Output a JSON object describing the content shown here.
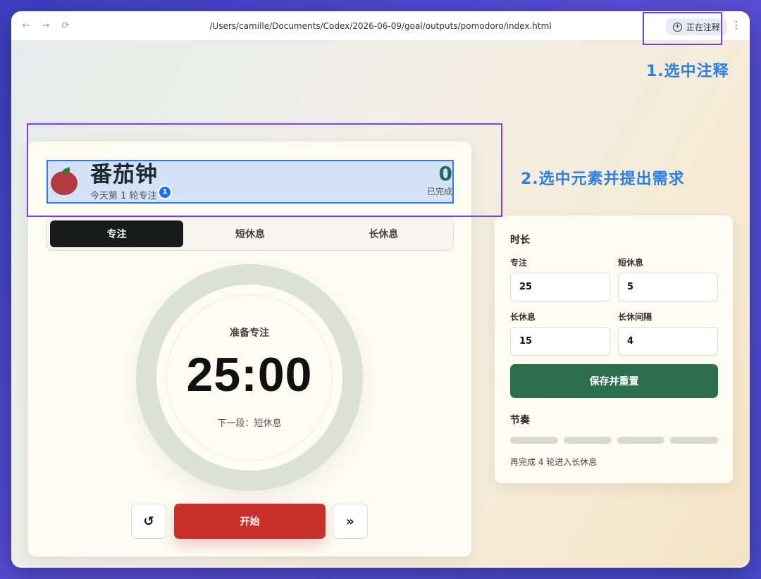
{
  "browser": {
    "url": "/Users/camille/Documents/Codex/2026-06-09/goal/outputs/pomodoro/index.html",
    "annotate_label": "正在注释",
    "more_label": "⋮",
    "nav_icons": [
      "arrow-left-icon",
      "arrow-right-icon",
      "reload-icon"
    ]
  },
  "app": {
    "title": "番茄钟",
    "subtitle": "今天第 1 轮专注",
    "badge": "1",
    "completed_count": "0",
    "completed_label": "已完成",
    "tabs": [
      "专注",
      "短休息",
      "长休息"
    ],
    "active_tab": 0,
    "phase": "准备专注",
    "time": "25:00",
    "next_phase": "下一段：短休息",
    "start_label": "开始",
    "reset_icon": "↺",
    "skip_icon": "»"
  },
  "settings": {
    "duration_title": "时长",
    "fields": [
      {
        "label": "专注",
        "value": "25"
      },
      {
        "label": "短休息",
        "value": "5"
      },
      {
        "label": "长休息",
        "value": "15"
      },
      {
        "label": "长休间隔",
        "value": "4"
      }
    ],
    "save_label": "保存并重置",
    "rhythm_title": "节奏",
    "rhythm_segments": 4,
    "rhythm_note": "再完成 4 轮进入长休息"
  },
  "annotations": {
    "step1": "1.选中注释",
    "step2": "2.选中元素并提出需求"
  },
  "colors": {
    "accent_blue": "#2d7fe0",
    "highlight_purple": "#7a3ee6",
    "start_red": "#c9302c",
    "save_green": "#2d6e4c",
    "tab_active": "#191b1a"
  }
}
